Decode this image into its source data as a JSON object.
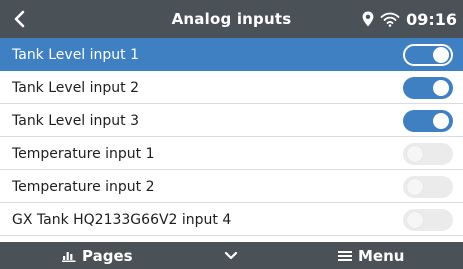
{
  "header": {
    "title": "Analog inputs",
    "time": "09:16",
    "icons": [
      "back-chevron",
      "location-pin",
      "wifi"
    ]
  },
  "inputs": [
    {
      "label": "Tank Level input 1",
      "enabled": true,
      "selected": true
    },
    {
      "label": "Tank Level input 2",
      "enabled": true,
      "selected": false
    },
    {
      "label": "Tank Level input 3",
      "enabled": true,
      "selected": false
    },
    {
      "label": "Temperature input 1",
      "enabled": false,
      "selected": false
    },
    {
      "label": "Temperature input 2",
      "enabled": false,
      "selected": false
    },
    {
      "label": "GX Tank HQ2133G66V2 input 4",
      "enabled": false,
      "selected": false
    }
  ],
  "footer": {
    "pages_label": "Pages",
    "menu_label": "Menu",
    "icons": [
      "bar-chart",
      "chevron-down",
      "hamburger"
    ]
  },
  "colors": {
    "header_bg": "#4a5258",
    "accent": "#3f80c2",
    "toggle_off": "#ebebeb"
  }
}
